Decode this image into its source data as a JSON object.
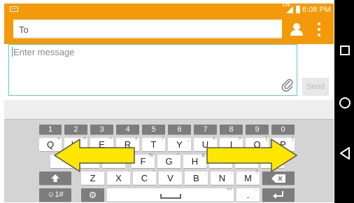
{
  "status_bar": {
    "network": "LTE",
    "time": "6:08 PM"
  },
  "recipient": {
    "placeholder": "To"
  },
  "message": {
    "placeholder": "Enter message",
    "send_label": "Send"
  },
  "keyboard": {
    "number_row": [
      {
        "label": "1"
      },
      {
        "label": "2"
      },
      {
        "label": "3"
      },
      {
        "label": "4"
      },
      {
        "label": "5"
      },
      {
        "label": "6"
      },
      {
        "label": "7"
      },
      {
        "label": "8"
      },
      {
        "label": "9"
      },
      {
        "label": "0"
      }
    ],
    "row1": [
      {
        "label": "Q",
        "hint": "+"
      },
      {
        "label": "W",
        "hint": "×"
      },
      {
        "label": "E",
        "hint": "÷"
      },
      {
        "label": "R",
        "hint": "="
      },
      {
        "label": "T",
        "hint": "/"
      },
      {
        "label": "Y",
        "hint": "_"
      },
      {
        "label": "U",
        "hint": "<"
      },
      {
        "label": "I",
        "hint": ">"
      },
      {
        "label": "O",
        "hint": "["
      },
      {
        "label": "P",
        "hint": "]"
      }
    ],
    "row2_visible": [
      {
        "label": "F",
        "hint": "%"
      },
      {
        "label": "G",
        "hint": "^"
      },
      {
        "label": "H",
        "hint": "&"
      }
    ],
    "row3": [
      {
        "label": "Z",
        "hint": "-"
      },
      {
        "label": "X",
        "hint": "'"
      },
      {
        "label": "C",
        "hint": "\""
      },
      {
        "label": "V",
        "hint": ":"
      },
      {
        "label": "B",
        "hint": ";"
      },
      {
        "label": "N",
        "hint": ","
      },
      {
        "label": "M",
        "hint": "?"
      }
    ],
    "symbols_label": "☺1#",
    "space_hint": "«»",
    "period_label": ".",
    "period_hint": "…"
  },
  "colors": {
    "accent": "#f49a0a",
    "keyboard_bg": "#d4d4d4",
    "arrow_fill": "#ffe600",
    "focus_border": "#5fcdc5"
  }
}
